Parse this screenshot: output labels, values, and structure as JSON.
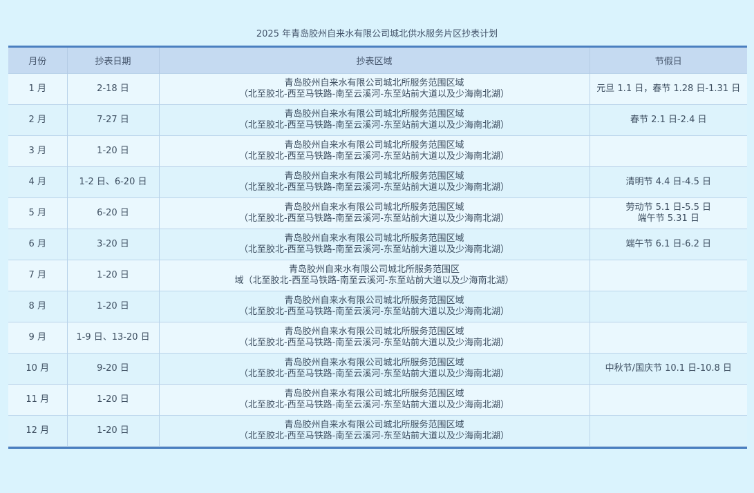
{
  "title": "2025 年青岛胶州自来水有限公司城北供水服务片区抄表计划",
  "headers": [
    "月份",
    "抄表日期",
    "抄表区域",
    "节假日"
  ],
  "rows": [
    {
      "month": "1 月",
      "dates": "2-18 日",
      "area1": "青岛胶州自来水有限公司城北所服务范围区域",
      "area2": "（北至胶北-西至马铁路-南至云溪河-东至站前大道以及少海南北湖）",
      "holiday1": "元旦 1.1 日，春节 1.28 日-1.31 日",
      "holiday2": ""
    },
    {
      "month": "2 月",
      "dates": "7-27 日",
      "area1": "青岛胶州自来水有限公司城北所服务范围区域",
      "area2": "（北至胶北-西至马铁路-南至云溪河-东至站前大道以及少海南北湖）",
      "holiday1": "春节 2.1 日-2.4 日",
      "holiday2": ""
    },
    {
      "month": "3 月",
      "dates": "1-20 日",
      "area1": "青岛胶州自来水有限公司城北所服务范围区域",
      "area2": "（北至胶北-西至马铁路-南至云溪河-东至站前大道以及少海南北湖）",
      "holiday1": "",
      "holiday2": ""
    },
    {
      "month": "4 月",
      "dates": "1-2 日、6-20 日",
      "area1": "青岛胶州自来水有限公司城北所服务范围区域",
      "area2": "（北至胶北-西至马铁路-南至云溪河-东至站前大道以及少海南北湖）",
      "holiday1": "清明节 4.4 日-4.5 日",
      "holiday2": ""
    },
    {
      "month": "5 月",
      "dates": "6-20 日",
      "area1": "青岛胶州自来水有限公司城北所服务范围区域",
      "area2": "（北至胶北-西至马铁路-南至云溪河-东至站前大道以及少海南北湖）",
      "holiday1": "劳动节 5.1 日-5.5 日",
      "holiday2": "端午节 5.31 日"
    },
    {
      "month": "6 月",
      "dates": "3-20 日",
      "area1": "青岛胶州自来水有限公司城北所服务范围区域",
      "area2": "（北至胶北-西至马铁路-南至云溪河-东至站前大道以及少海南北湖）",
      "holiday1": "端午节 6.1 日-6.2 日",
      "holiday2": ""
    },
    {
      "month": "7 月",
      "dates": "1-20 日",
      "area1": "青岛胶州自来水有限公司城北所服务范围区",
      "area2": "域（北至胶北-西至马铁路-南至云溪河-东至站前大道以及少海南北湖）",
      "holiday1": "",
      "holiday2": ""
    },
    {
      "month": "8 月",
      "dates": "1-20 日",
      "area1": "青岛胶州自来水有限公司城北所服务范围区域",
      "area2": "（北至胶北-西至马铁路-南至云溪河-东至站前大道以及少海南北湖）",
      "holiday1": "",
      "holiday2": ""
    },
    {
      "month": "9 月",
      "dates": "1-9 日、13-20 日",
      "area1": "青岛胶州自来水有限公司城北所服务范围区域",
      "area2": "（北至胶北-西至马铁路-南至云溪河-东至站前大道以及少海南北湖）",
      "holiday1": "",
      "holiday2": ""
    },
    {
      "month": "10 月",
      "dates": "9-20 日",
      "area1": "青岛胶州自来水有限公司城北所服务范围区域",
      "area2": "（北至胶北-西至马铁路-南至云溪河-东至站前大道以及少海南北湖）",
      "holiday1": "中秋节/国庆节 10.1 日-10.8 日",
      "holiday2": ""
    },
    {
      "month": "11 月",
      "dates": "1-20 日",
      "area1": "青岛胶州自来水有限公司城北所服务范围区域",
      "area2": "（北至胶北-西至马铁路-南至云溪河-东至站前大道以及少海南北湖）",
      "holiday1": "",
      "holiday2": ""
    },
    {
      "month": "12 月",
      "dates": "1-20 日",
      "area1": "青岛胶州自来水有限公司城北所服务范围区域",
      "area2": "（北至胶北-西至马铁路-南至云溪河-东至站前大道以及少海南北湖）",
      "holiday1": "",
      "holiday2": ""
    }
  ]
}
